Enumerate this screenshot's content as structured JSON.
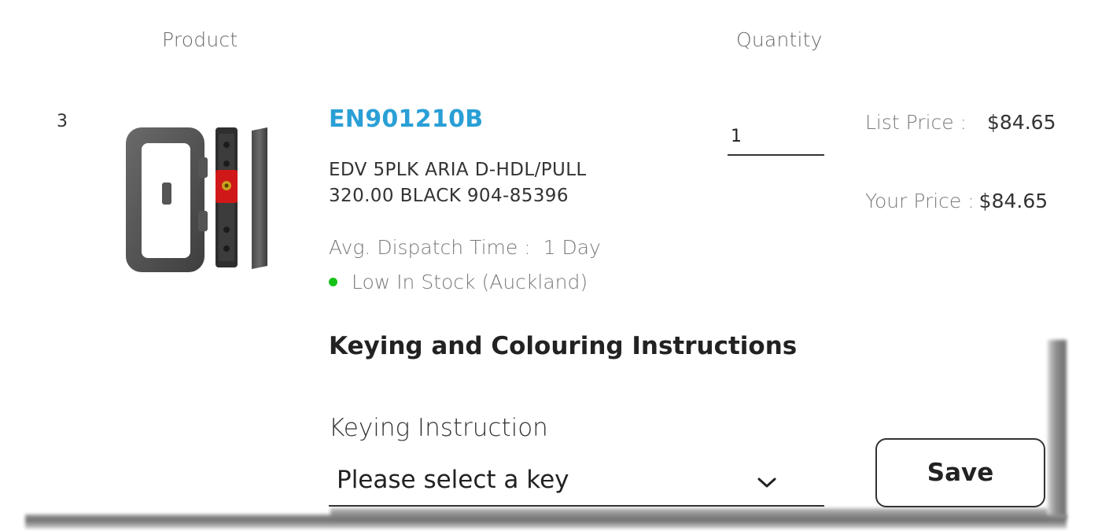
{
  "headers": {
    "product": "Product",
    "quantity": "Quantity"
  },
  "item": {
    "line_number": "3",
    "sku": "EN901210B",
    "description_line1": "EDV 5PLK ARIA D-HDL/PULL",
    "description_line2": "320.00 BLACK 904-85396",
    "dispatch_label": "Avg. Dispatch Time :",
    "dispatch_value": "1 Day",
    "stock_status": "Low In Stock (Auckland)",
    "stock_color": "#17c217",
    "quantity_value": "1",
    "list_price_label": "List Price :",
    "list_price": "$84.65",
    "your_price_label": "Your Price :",
    "your_price": "$84.65",
    "image_icon": "door-handle-product-image"
  },
  "keying": {
    "title": "Keying and Colouring Instructions",
    "label": "Keying Instruction",
    "selected_value": "Please select a key",
    "save_label": "Save"
  },
  "colors": {
    "sku_link": "#2a9fd6",
    "text_dark": "#222222",
    "text_muted": "#7a7a7a"
  }
}
